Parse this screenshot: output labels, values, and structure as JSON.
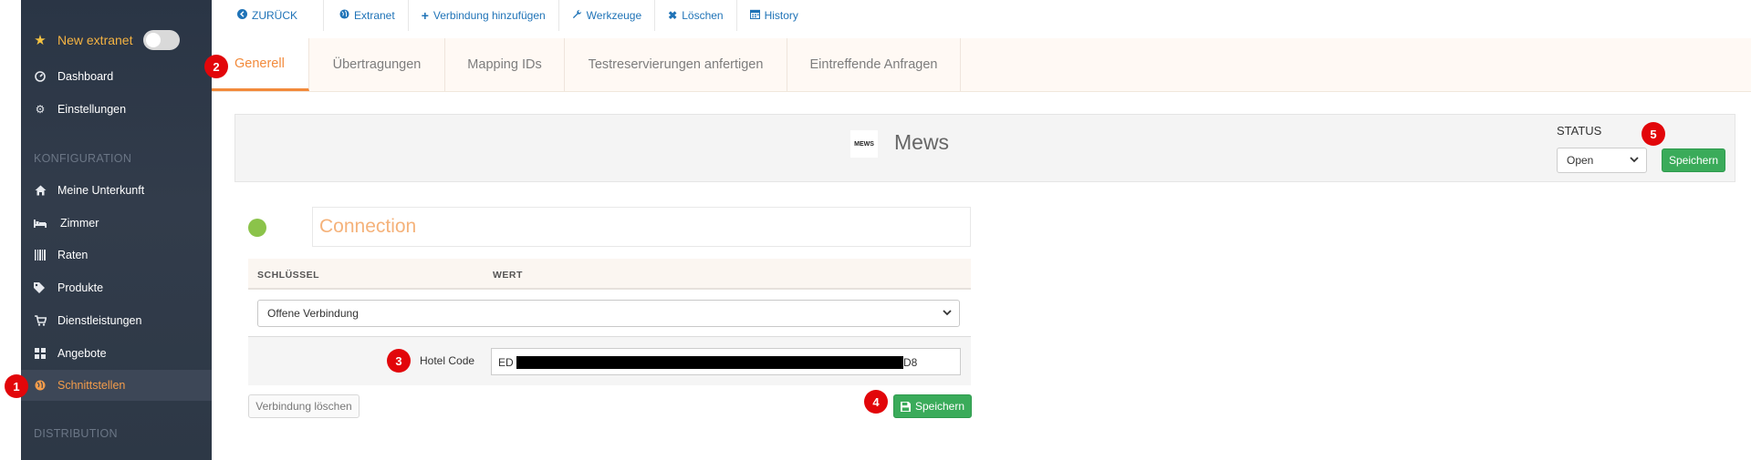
{
  "sidebar": {
    "new_extranet": "New extranet",
    "items": [
      {
        "label": "Dashboard",
        "icon": "dashboard-icon"
      },
      {
        "label": "Einstellungen",
        "icon": "gear-icon"
      }
    ],
    "section_konfiguration": "KONFIGURATION",
    "config_items": [
      {
        "label": "Meine Unterkunft",
        "icon": "home-icon"
      },
      {
        "label": "Zimmer",
        "icon": "bed-icon"
      },
      {
        "label": "Raten",
        "icon": "barcode-icon"
      },
      {
        "label": "Produkte",
        "icon": "tags-icon"
      },
      {
        "label": "Dienstleistungen",
        "icon": "cart-icon"
      },
      {
        "label": "Angebote",
        "icon": "grid-icon"
      },
      {
        "label": "Schnittstellen",
        "icon": "globe-icon",
        "active": true
      }
    ],
    "section_distribution": "DISTRIBUTION"
  },
  "toolbar": {
    "back": "ZURÜCK",
    "extranet": "Extranet",
    "add_connection": "Verbindung hinzufügen",
    "tools": "Werkzeuge",
    "delete": "Löschen",
    "history": "History"
  },
  "tabs": [
    "Generell",
    "Übertragungen",
    "Mapping IDs",
    "Testreservierungen anfertigen",
    "Eintreffende Anfragen"
  ],
  "header": {
    "logo_text": "MEWS",
    "title": "Mews",
    "status_label": "STATUS",
    "status_value": "Open",
    "save": "Speichern"
  },
  "connection": {
    "title": "Connection",
    "col_key": "SCHLÜSSEL",
    "col_value": "WERT",
    "select_value": "Offene Verbindung",
    "hotel_code_label": "Hotel Code",
    "hotel_code_prefix": "ED",
    "hotel_code_suffix": "D8",
    "delete_button": "Verbindung löschen",
    "save_button": "Speichern"
  },
  "badges": [
    "1",
    "2",
    "3",
    "4",
    "5"
  ],
  "colors": {
    "accent_orange": "#f28a3b",
    "save_green": "#3aab5a",
    "badge_red": "#e2060a",
    "link_blue": "#1f73b7",
    "status_green": "#8bc34a"
  }
}
